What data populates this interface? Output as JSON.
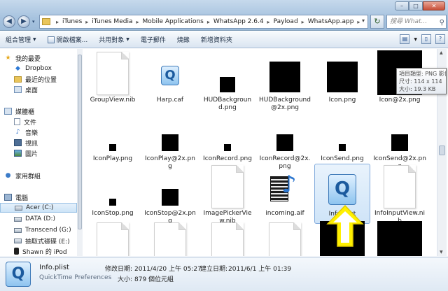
{
  "window": {
    "minimize": "–",
    "maximize": "□",
    "close": "✕"
  },
  "nav_buttons": {
    "back": "◀",
    "forward": "▶",
    "dropdown": "▾"
  },
  "breadcrumb": [
    "iTunes",
    "iTunes Media",
    "Mobile Applications",
    "WhatsApp 2.6.4",
    "Payload",
    "WhatsApp.app"
  ],
  "breadcrumb_separator": "▸",
  "search": {
    "placeholder": "搜尋 What..."
  },
  "toolbar": {
    "organize": "組合管理",
    "open": "開啟檔案...",
    "share": "共用對象",
    "email": "電子郵件",
    "burn": "燒錄",
    "new_folder": "新增資料夾"
  },
  "navigation": {
    "favorites": "我的最愛",
    "dropbox": "Dropbox",
    "recent": "最近的位置",
    "desktop": "桌面",
    "libraries": "媒體櫃",
    "documents": "文件",
    "music": "音樂",
    "videos": "視訊",
    "pictures": "圖片",
    "homegroup": "家用群組",
    "computer": "電腦",
    "drive_c": "Acer (C:)",
    "drive_d": "DATA (D:)",
    "drive_g": "Transcend (G:)",
    "drive_e": "抽取式磁碟 (E:)",
    "ipod": "Shawn 的 iPod"
  },
  "files": [
    {
      "name": "GroupView.nib",
      "thumb": "doc"
    },
    {
      "name": "Harp.caf",
      "thumb": "qt"
    },
    {
      "name": "HUDBackground.png",
      "thumb": "black-sm"
    },
    {
      "name": "HUDBackground@2x.png",
      "thumb": "black-md"
    },
    {
      "name": "Icon.png",
      "thumb": "black-md"
    },
    {
      "name": "Icon@2x.png",
      "thumb": "black-lg"
    },
    {
      "name": "IconPlay.png",
      "thumb": "black-xs"
    },
    {
      "name": "IconPlay@2x.png",
      "thumb": "black-s2"
    },
    {
      "name": "IconRecord.png",
      "thumb": "black-xs"
    },
    {
      "name": "IconRecord@2x.png",
      "thumb": "black-s2"
    },
    {
      "name": "IconSend.png",
      "thumb": "black-xs"
    },
    {
      "name": "IconSend@2x.png",
      "thumb": "black-s2"
    },
    {
      "name": "IconStop.png",
      "thumb": "black-xs"
    },
    {
      "name": "IconStop@2x.png",
      "thumb": "black-s2"
    },
    {
      "name": "ImagePickerView.nib",
      "thumb": "doc"
    },
    {
      "name": "incoming.aif",
      "thumb": "aif"
    },
    {
      "name": "Info.plist",
      "thumb": "qt-big",
      "selected": true
    },
    {
      "name": "InfoInputView.nib",
      "thumb": "doc"
    },
    {
      "name": "",
      "thumb": "doc"
    },
    {
      "name": "",
      "thumb": "doc"
    },
    {
      "name": "",
      "thumb": "doc"
    },
    {
      "name": "",
      "thumb": "doc"
    },
    {
      "name": "",
      "thumb": "black-lg"
    },
    {
      "name": "",
      "thumb": "black-lg"
    }
  ],
  "tooltip": {
    "type": "項目類型: PNG 影像",
    "dimensions": "尺寸: 114 x 114",
    "size": "大小: 19.3 KB"
  },
  "details": {
    "name": "Info.plist",
    "type": "QuickTime Preferences",
    "modified_label": "修改日期:",
    "modified": "2011/4/20 上午 05:27",
    "created_label": "建立日期:",
    "created": "2011/6/1 上午 01:39",
    "size_label": "大小:",
    "size": "879 個位元組"
  },
  "colors": {
    "accent": "#3d79b8",
    "arrow": "#fff000",
    "selection": "#cfe4f8"
  }
}
